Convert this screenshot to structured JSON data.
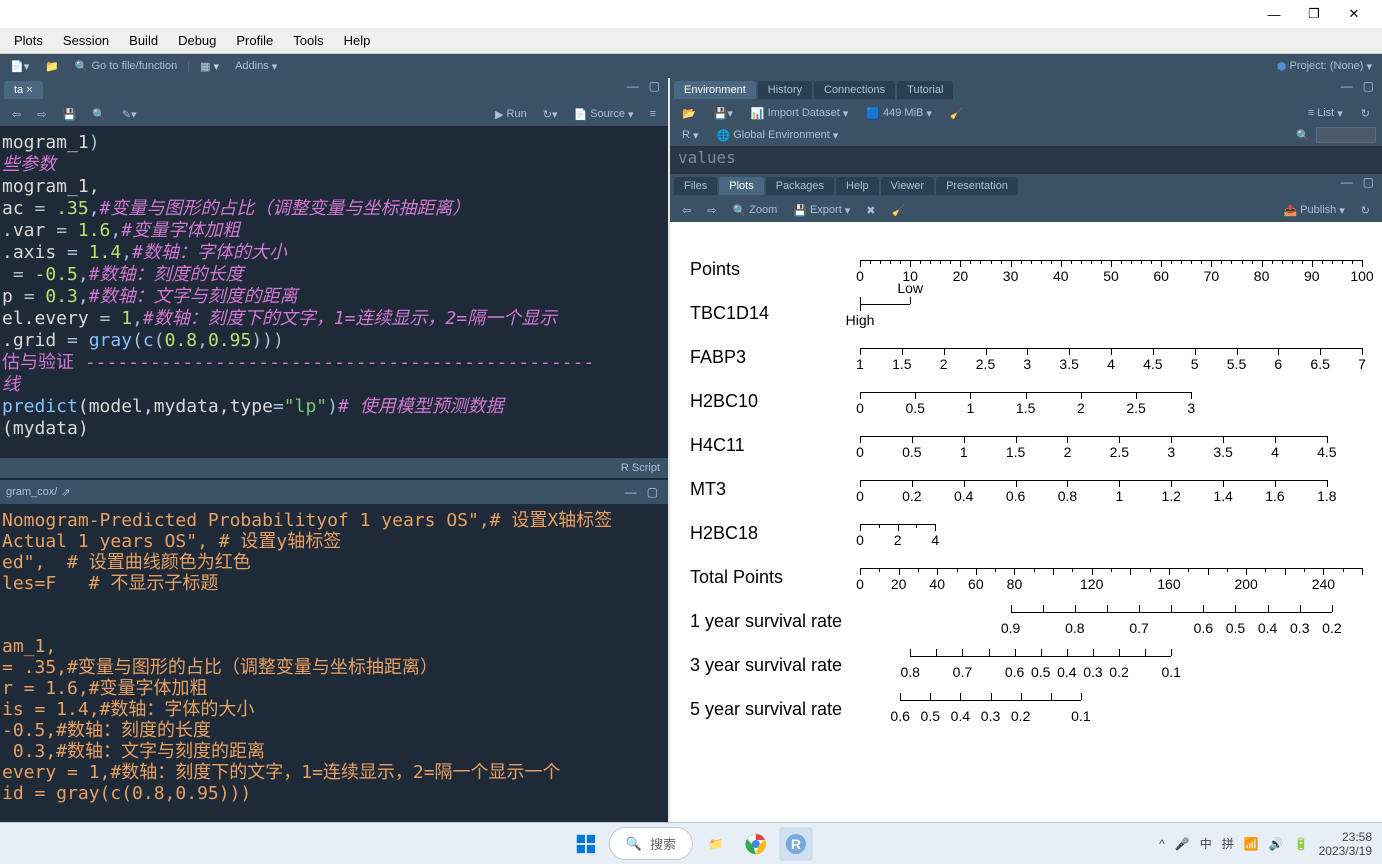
{
  "window": {
    "minimize": "—",
    "maximize": "❐",
    "close": "✕"
  },
  "menubar": [
    "Plots",
    "Session",
    "Build",
    "Debug",
    "Profile",
    "Tools",
    "Help"
  ],
  "toolbar": {
    "goto": "Go to file/function",
    "addins": "Addins",
    "project": "Project: (None)"
  },
  "source": {
    "tab": "ta",
    "run": "Run",
    "source_btn": "Source",
    "footer": "R Script",
    "lines": [
      {
        "segs": [
          {
            "t": "mogram_1",
            "c": "tok-var"
          },
          {
            "t": ")",
            "c": "tok-op"
          }
        ]
      },
      {
        "segs": [
          {
            "t": "些参数",
            "c": "tok-cmt"
          }
        ]
      },
      {
        "segs": [
          {
            "t": "mogram_1,",
            "c": "tok-var"
          }
        ]
      },
      {
        "segs": [
          {
            "t": "ac ",
            "c": "tok-var"
          },
          {
            "t": "= ",
            "c": "tok-op"
          },
          {
            "t": ".35",
            "c": "tok-num"
          },
          {
            "t": ",",
            "c": "tok-op"
          },
          {
            "t": "#变量与图形的占比（调整变量与坐标抽距离）",
            "c": "tok-cmt"
          }
        ]
      },
      {
        "segs": [
          {
            "t": ".var ",
            "c": "tok-var"
          },
          {
            "t": "= ",
            "c": "tok-op"
          },
          {
            "t": "1.6",
            "c": "tok-num"
          },
          {
            "t": ",",
            "c": "tok-op"
          },
          {
            "t": "#变量字体加粗",
            "c": "tok-cmt"
          }
        ]
      },
      {
        "segs": [
          {
            "t": ".axis ",
            "c": "tok-var"
          },
          {
            "t": "= ",
            "c": "tok-op"
          },
          {
            "t": "1.4",
            "c": "tok-num"
          },
          {
            "t": ",",
            "c": "tok-op"
          },
          {
            "t": "#数轴：字体的大小",
            "c": "tok-cmt"
          }
        ]
      },
      {
        "segs": [
          {
            "t": " = ",
            "c": "tok-op"
          },
          {
            "t": "-0.5",
            "c": "tok-num"
          },
          {
            "t": ",",
            "c": "tok-op"
          },
          {
            "t": "#数轴：刻度的长度",
            "c": "tok-cmt"
          }
        ]
      },
      {
        "segs": [
          {
            "t": "p ",
            "c": "tok-var"
          },
          {
            "t": "= ",
            "c": "tok-op"
          },
          {
            "t": "0.3",
            "c": "tok-num"
          },
          {
            "t": ",",
            "c": "tok-op"
          },
          {
            "t": "#数轴：文字与刻度的距离",
            "c": "tok-cmt"
          }
        ]
      },
      {
        "segs": [
          {
            "t": "el.every ",
            "c": "tok-var"
          },
          {
            "t": "= ",
            "c": "tok-op"
          },
          {
            "t": "1",
            "c": "tok-num"
          },
          {
            "t": ",",
            "c": "tok-op"
          },
          {
            "t": "#数轴：刻度下的文字，1=连续显示，2=隔一个显示",
            "c": "tok-cmt"
          }
        ]
      },
      {
        "segs": [
          {
            "t": ".grid ",
            "c": "tok-var"
          },
          {
            "t": "= ",
            "c": "tok-op"
          },
          {
            "t": "gray",
            "c": "tok-fn"
          },
          {
            "t": "(",
            "c": "tok-op"
          },
          {
            "t": "c",
            "c": "tok-fn"
          },
          {
            "t": "(",
            "c": "tok-op"
          },
          {
            "t": "0.8",
            "c": "tok-num"
          },
          {
            "t": ",",
            "c": "tok-op"
          },
          {
            "t": "0.95",
            "c": "tok-num"
          },
          {
            "t": ")))",
            "c": "tok-op"
          }
        ]
      },
      {
        "segs": [
          {
            "t": "",
            "c": "tok-op"
          }
        ]
      },
      {
        "segs": [
          {
            "t": "估与验证 -----------------------------------------------",
            "c": "tok-dash"
          }
        ]
      },
      {
        "segs": [
          {
            "t": "线",
            "c": "tok-cmt"
          }
        ]
      },
      {
        "segs": [
          {
            "t": "predict",
            "c": "tok-fn"
          },
          {
            "t": "(model,mydata,",
            "c": "tok-var"
          },
          {
            "t": "type",
            "c": "tok-var"
          },
          {
            "t": "=",
            "c": "tok-op"
          },
          {
            "t": "\"lp\"",
            "c": "tok-str"
          },
          {
            "t": ")",
            "c": "tok-op"
          },
          {
            "t": "# 使用模型预测数据",
            "c": "tok-cmt"
          }
        ]
      },
      {
        "segs": [
          {
            "t": "(mydata)",
            "c": "tok-var"
          }
        ]
      }
    ]
  },
  "console": {
    "path": "gram_cox/",
    "lines": [
      "Nomogram-Predicted Probabilityof 1 years OS\",# 设置X轴标签",
      "Actual 1 years OS\", # 设置y轴标签",
      "ed\",  # 设置曲线颜色为红色",
      "les=F   # 不显示子标题",
      "",
      "",
      "am_1,",
      "= .35,#变量与图形的占比（调整变量与坐标抽距离）",
      "r = 1.6,#变量字体加粗",
      "is = 1.4,#数轴：字体的大小",
      "-0.5,#数轴：刻度的长度",
      " 0.3,#数轴：文字与刻度的距离",
      "every = 1,#数轴：刻度下的文字，1=连续显示，2=隔一个显示一个",
      "id = gray(c(0.8,0.95)))"
    ]
  },
  "env": {
    "tabs": [
      "Environment",
      "History",
      "Connections",
      "Tutorial"
    ],
    "import": "Import Dataset",
    "memory": "449 MiB",
    "list": "List",
    "scope_r": "R",
    "scope": "Global Environment",
    "body": "values"
  },
  "viewer": {
    "tabs": [
      "Files",
      "Plots",
      "Packages",
      "Help",
      "Viewer",
      "Presentation"
    ],
    "zoom": "Zoom",
    "export": "Export",
    "publish": "Publish"
  },
  "nomogram": {
    "rows": [
      {
        "label": "Points",
        "ticks": [
          "0",
          "10",
          "20",
          "30",
          "40",
          "50",
          "60",
          "70",
          "80",
          "90",
          "100"
        ],
        "from": 0,
        "to": 100,
        "minor": 5
      },
      {
        "label": "TBC1D14",
        "special": "tbc",
        "high": "High",
        "low": "Low"
      },
      {
        "label": "FABP3",
        "ticks": [
          "1",
          "1.5",
          "2",
          "2.5",
          "3",
          "3.5",
          "4",
          "4.5",
          "5",
          "5.5",
          "6",
          "6.5",
          "7"
        ],
        "from": 0,
        "to": 100
      },
      {
        "label": "H2BC10",
        "ticks": [
          "0",
          "0.5",
          "1",
          "1.5",
          "2",
          "2.5",
          "3"
        ],
        "from": 0,
        "to": 66
      },
      {
        "label": "H4C11",
        "ticks": [
          "0",
          "0.5",
          "1",
          "1.5",
          "2",
          "2.5",
          "3",
          "3.5",
          "4",
          "4.5"
        ],
        "from": 0,
        "to": 93
      },
      {
        "label": "MT3",
        "ticks": [
          "0",
          "0.2",
          "0.4",
          "0.6",
          "0.8",
          "1",
          "1.2",
          "1.4",
          "1.6",
          "1.8"
        ],
        "from": 0,
        "to": 93
      },
      {
        "label": "H2BC18",
        "ticks": [
          "0",
          "2",
          "4"
        ],
        "from": 0,
        "to": 15,
        "minor": 2
      },
      {
        "label": "Total Points",
        "ticks": [
          "0",
          "20",
          "40",
          "60",
          "80",
          "",
          "120",
          "",
          "160",
          "",
          "200",
          "",
          "240",
          ""
        ],
        "from": 0,
        "to": 100,
        "minor": 2
      },
      {
        "label": "1 year survival rate",
        "ticks": [
          "0.9",
          "",
          "0.8",
          "",
          "0.7",
          "",
          "0.6",
          "0.5",
          "0.4",
          "0.3",
          "0.2"
        ],
        "from": 30,
        "to": 94,
        "up": true
      },
      {
        "label": "3 year survival rate",
        "ticks": [
          "0.8",
          "",
          "0.7",
          "",
          "0.6",
          "0.5",
          "0.4",
          "0.3",
          "0.2",
          "",
          "0.1"
        ],
        "from": 10,
        "to": 62,
        "up": true
      },
      {
        "label": "5 year survival rate",
        "ticks": [
          "0.6",
          "0.5",
          "0.4",
          "0.3",
          "0.2",
          "",
          "0.1"
        ],
        "from": 8,
        "to": 44,
        "up": true
      }
    ]
  },
  "taskbar": {
    "search": "搜索",
    "time": "23:58",
    "date": "2023/3/19",
    "ime1": "中",
    "ime2": "拼"
  },
  "chart_data": {
    "type": "nomogram",
    "title": "Nomogram",
    "points_scale": {
      "min": 0,
      "max": 100,
      "step": 10
    },
    "predictors": [
      {
        "name": "TBC1D14",
        "type": "categorical",
        "levels": [
          "High",
          "Low"
        ],
        "positions": [
          0,
          10
        ]
      },
      {
        "name": "FABP3",
        "type": "continuous",
        "range": [
          1,
          7
        ],
        "step": 0.5,
        "span_pct": 100
      },
      {
        "name": "H2BC10",
        "type": "continuous",
        "range": [
          0,
          3
        ],
        "step": 0.5,
        "span_pct": 66
      },
      {
        "name": "H4C11",
        "type": "continuous",
        "range": [
          0,
          4.5
        ],
        "step": 0.5,
        "span_pct": 93
      },
      {
        "name": "MT3",
        "type": "continuous",
        "range": [
          0,
          1.8
        ],
        "step": 0.2,
        "span_pct": 93
      },
      {
        "name": "H2BC18",
        "type": "continuous",
        "range": [
          0,
          4
        ],
        "step": 2,
        "span_pct": 15
      }
    ],
    "total_points": {
      "min": 0,
      "max": 260,
      "step": 20
    },
    "outcomes": [
      {
        "name": "1 year survival rate",
        "probs": [
          0.9,
          0.8,
          0.7,
          0.6,
          0.5,
          0.4,
          0.3,
          0.2
        ]
      },
      {
        "name": "3 year survival rate",
        "probs": [
          0.8,
          0.7,
          0.6,
          0.5,
          0.4,
          0.3,
          0.2,
          0.1
        ]
      },
      {
        "name": "5 year survival rate",
        "probs": [
          0.6,
          0.5,
          0.4,
          0.3,
          0.2,
          0.1
        ]
      }
    ]
  }
}
